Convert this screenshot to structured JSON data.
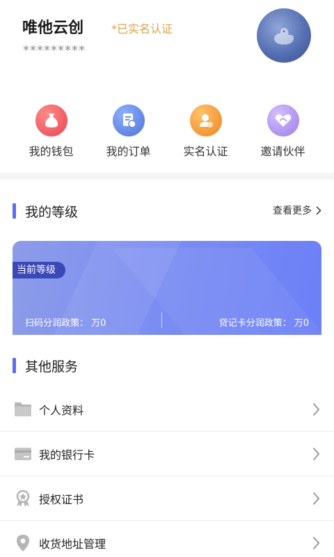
{
  "profile": {
    "name": "唯他云创",
    "verified_text": "*已实名认证",
    "masked_id": "*********"
  },
  "quick_actions": [
    {
      "label": "我的钱包",
      "icon": "wallet-icon",
      "color": "#f0595f"
    },
    {
      "label": "我的订单",
      "icon": "order-icon",
      "color": "#5b86e5"
    },
    {
      "label": "实名认证",
      "icon": "verify-user-icon",
      "color": "#f29a2e"
    },
    {
      "label": "邀请伙伴",
      "icon": "handshake-icon",
      "color": "#a98ae8"
    }
  ],
  "level_section": {
    "title": "我的等级",
    "more_label": "查看更多",
    "badge": "当前等级",
    "scan_policy": "扫码分润政策： 万0",
    "debit_policy": "贷记卡分润政策： 万0"
  },
  "services_section": {
    "title": "其他服务",
    "items": [
      {
        "label": "个人资料",
        "icon": "folder-icon"
      },
      {
        "label": "我的银行卡",
        "icon": "bank-card-icon"
      },
      {
        "label": "授权证书",
        "icon": "certificate-icon"
      },
      {
        "label": "收货地址管理",
        "icon": "location-pin-icon"
      }
    ]
  },
  "colors": {
    "accent": "#5b6ff0",
    "verified": "#d9a34a"
  }
}
